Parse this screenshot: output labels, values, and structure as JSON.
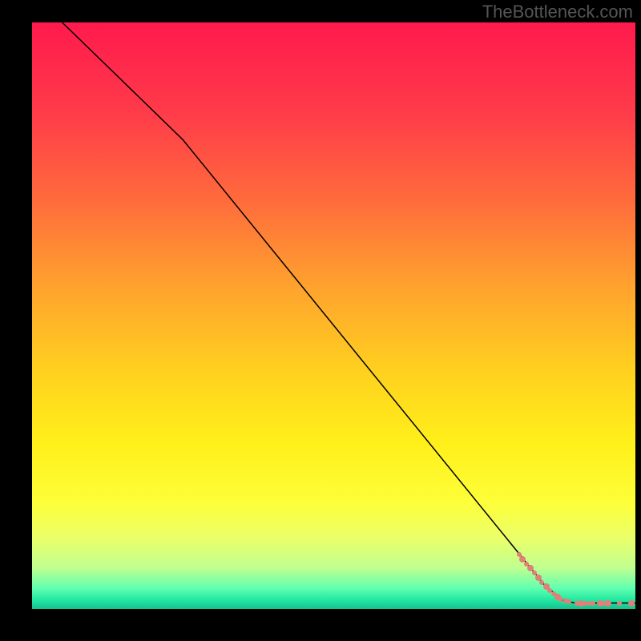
{
  "watermark": "TheBottleneck.com",
  "chart_data": {
    "type": "line",
    "title": "",
    "xlabel": "",
    "ylabel": "",
    "xlim": [
      0,
      100
    ],
    "ylim": [
      0,
      100
    ],
    "gradient_stops": [
      {
        "offset": 0.0,
        "color": "#ff1a4d"
      },
      {
        "offset": 0.15,
        "color": "#ff3a4a"
      },
      {
        "offset": 0.3,
        "color": "#ff6a3c"
      },
      {
        "offset": 0.45,
        "color": "#ffa22e"
      },
      {
        "offset": 0.6,
        "color": "#ffd21e"
      },
      {
        "offset": 0.72,
        "color": "#fff01a"
      },
      {
        "offset": 0.82,
        "color": "#fdff3a"
      },
      {
        "offset": 0.88,
        "color": "#eaff6a"
      },
      {
        "offset": 0.93,
        "color": "#c0ff90"
      },
      {
        "offset": 0.965,
        "color": "#60ffb0"
      },
      {
        "offset": 0.985,
        "color": "#20e8a0"
      },
      {
        "offset": 1.0,
        "color": "#18c090"
      }
    ],
    "line": {
      "x": [
        5,
        25,
        85,
        88,
        90,
        100
      ],
      "y": [
        100,
        80,
        4,
        1.5,
        1,
        1
      ]
    },
    "scatter": {
      "x": [
        80.7,
        81.3,
        82.0,
        82.6,
        83.3,
        83.9,
        84.5,
        85.2,
        85.8,
        86.5,
        87.1,
        87.7,
        88.4,
        89.0,
        90.3,
        91.0,
        91.6,
        92.3,
        92.9,
        94.2,
        94.8,
        95.5,
        97.4,
        99.3
      ],
      "y": [
        9.3,
        8.5,
        7.7,
        6.9,
        6.1,
        5.3,
        4.5,
        3.8,
        3.2,
        2.6,
        2.1,
        1.7,
        1.4,
        1.2,
        1.0,
        1.0,
        1.0,
        1.0,
        1.0,
        1.0,
        1.0,
        1.0,
        1.0,
        1.0
      ],
      "sizes": [
        6,
        8,
        6,
        8,
        6,
        8,
        6,
        8,
        6,
        6,
        8,
        6,
        6,
        6,
        6,
        8,
        6,
        6,
        6,
        8,
        6,
        8,
        6,
        8
      ],
      "color": "#e08078"
    }
  }
}
